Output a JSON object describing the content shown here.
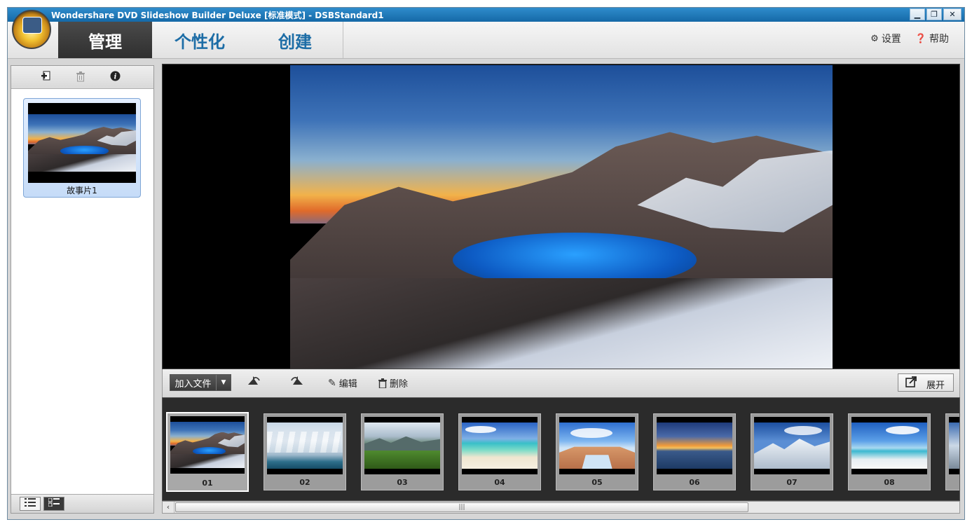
{
  "window": {
    "title": "Wondershare DVD Slideshow Builder Deluxe [标准模式] - DSBStandard1",
    "buttons": [
      "▁",
      "❐",
      "✕"
    ]
  },
  "tabs": [
    {
      "label": "管理",
      "active": true
    },
    {
      "label": "个性化",
      "active": false
    },
    {
      "label": "创建",
      "active": false
    }
  ],
  "toplinks": {
    "settings": {
      "icon": "⚙",
      "label": "设置"
    },
    "help": {
      "icon": "❓",
      "label": "帮助"
    }
  },
  "left_panel": {
    "story": {
      "label": "故事片1"
    },
    "view_modes": [
      "list",
      "thumbnail"
    ]
  },
  "storyboard_toolbar": {
    "add_file": "加入文件",
    "edit": "编辑",
    "delete": "删除",
    "expand": "展开"
  },
  "slides": [
    {
      "num": "01",
      "photo": "crater",
      "selected": true
    },
    {
      "num": "02",
      "photo": "clouds"
    },
    {
      "num": "03",
      "photo": "valley"
    },
    {
      "num": "04",
      "photo": "beach"
    },
    {
      "num": "05",
      "photo": "arch"
    },
    {
      "num": "06",
      "photo": "sunset"
    },
    {
      "num": "07",
      "photo": "snowmtn"
    },
    {
      "num": "08",
      "photo": "sea"
    },
    {
      "num": "",
      "photo": "edge"
    }
  ],
  "scrollbar": {
    "left_arrow": "‹",
    "grip": "|||"
  }
}
